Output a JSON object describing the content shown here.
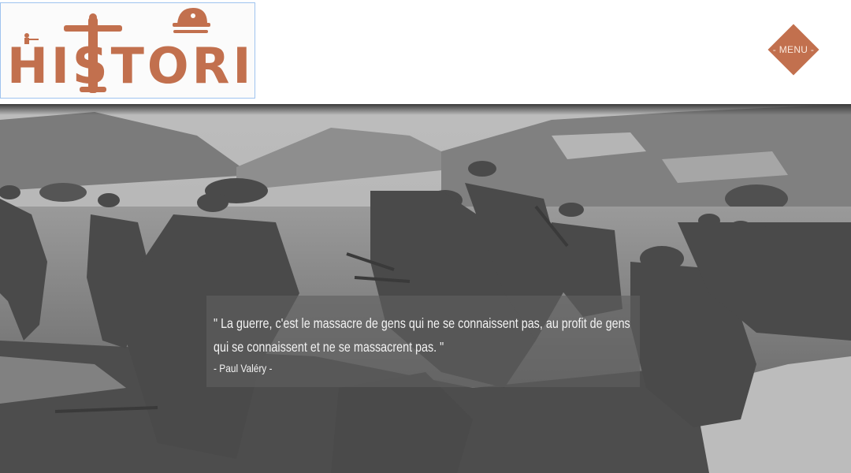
{
  "header": {
    "logo_text": "HISTORIKA",
    "menu_label": "- MENU -"
  },
  "hero": {
    "quote": "\" La guerre, c'est le massacre de gens qui ne se connaissent pas, au profit de gens qui se connaissent et ne se massacrent pas. \"",
    "author": "- Paul Valéry -"
  },
  "colors": {
    "brand": "#c2704e",
    "logo_border": "#9fc3ef"
  }
}
